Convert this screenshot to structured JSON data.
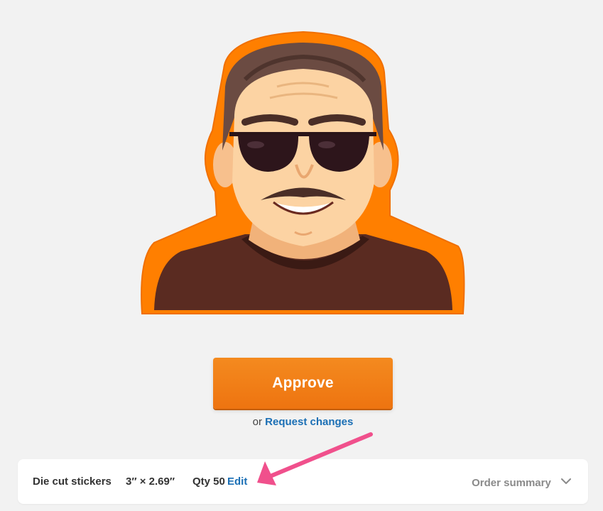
{
  "preview": {
    "image_name": "die-cut-sticker-portrait"
  },
  "actions": {
    "approve_label": "Approve",
    "or_text": "or",
    "request_changes_label": "Request changes"
  },
  "order_bar": {
    "product": "Die cut stickers",
    "size": "3″ × 2.69″",
    "qty": "Qty 50",
    "edit_label": "Edit",
    "summary_label": "Order summary",
    "summary_icon": "chevron-down-icon"
  },
  "colors": {
    "approve": "#f07d17",
    "link": "#1b6fb5",
    "sticker_border": "#ff7f00",
    "arrow": "#f0508c"
  }
}
